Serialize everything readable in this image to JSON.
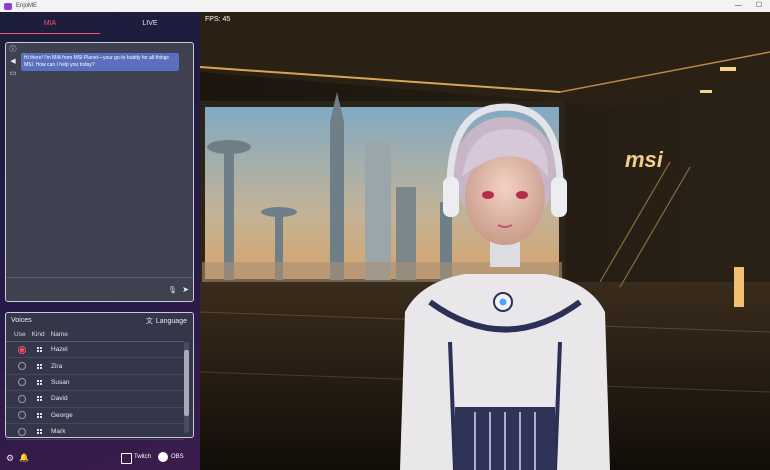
{
  "window": {
    "title": "EnjoME"
  },
  "tabs": [
    {
      "label": "MIA",
      "active": true
    },
    {
      "label": "LIVE",
      "active": false
    }
  ],
  "chat": {
    "message": "Hi there! I'm MIA from MSI Planet—your go-to buddy for all things MSI. How can I help you today?",
    "tools": [
      "info-icon",
      "speaker-icon",
      "chat-icon"
    ]
  },
  "voices": {
    "title": "Voices",
    "language_label": "Language",
    "columns": [
      "Use",
      "Kind",
      "Name"
    ],
    "items": [
      {
        "name": "Hazel",
        "selected": true
      },
      {
        "name": "Zira",
        "selected": false
      },
      {
        "name": "Susan",
        "selected": false
      },
      {
        "name": "David",
        "selected": false
      },
      {
        "name": "George",
        "selected": false
      },
      {
        "name": "Mark",
        "selected": false
      }
    ]
  },
  "footer": {
    "twitch_label": "Twitch",
    "obs_label": "OBS"
  },
  "scene": {
    "fps_label": "FPS: 45",
    "brand": "msi"
  },
  "colors": {
    "accent": "#ff4d6d",
    "bubble": "#5a6fbe"
  }
}
